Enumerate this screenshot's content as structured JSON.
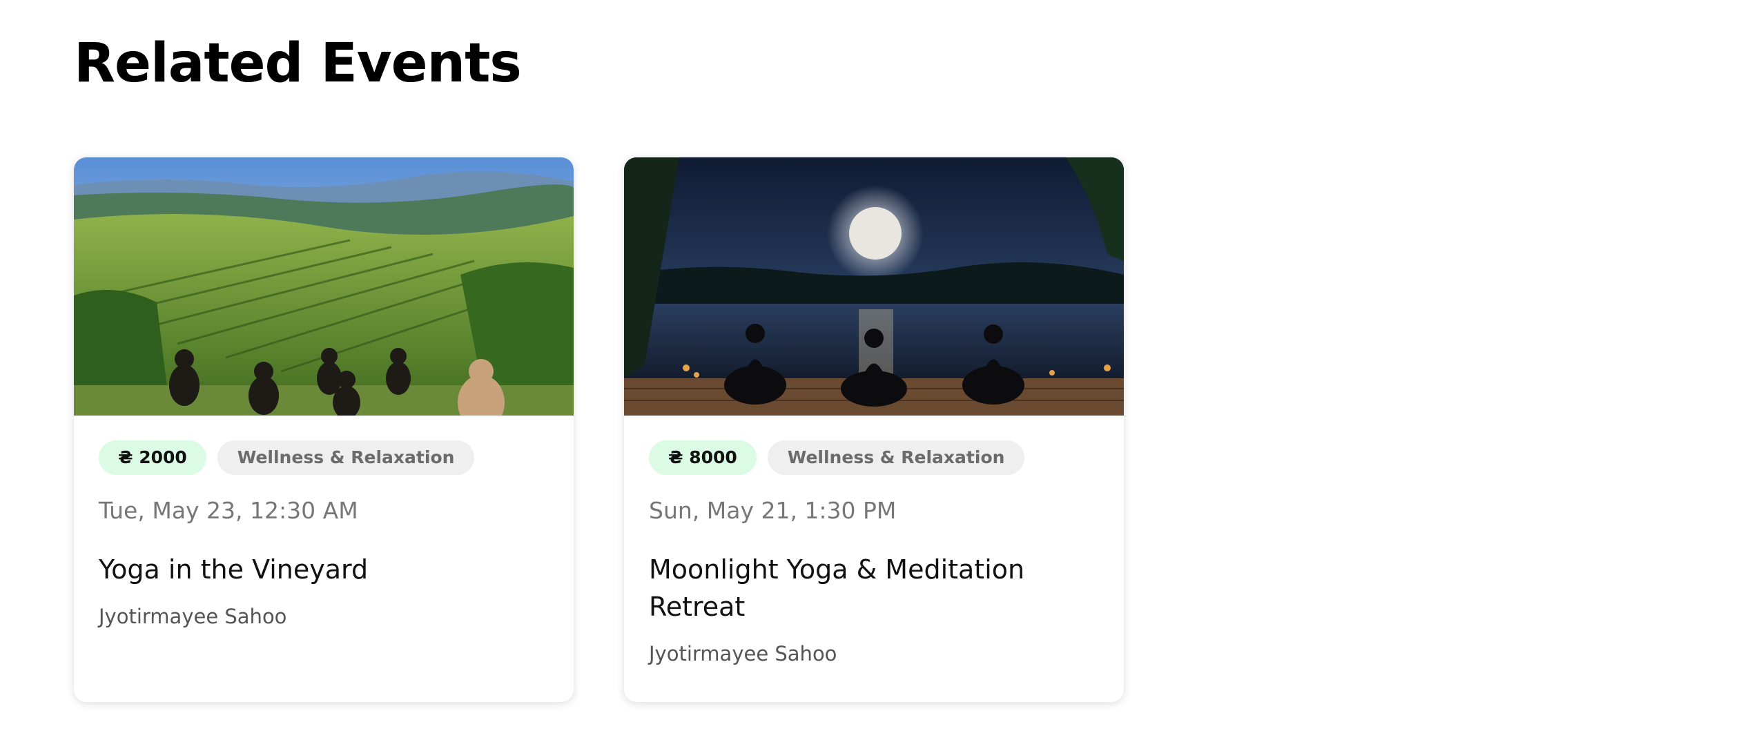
{
  "section": {
    "title": "Related Events"
  },
  "events": [
    {
      "price": "₴ 2000",
      "category": "Wellness & Relaxation",
      "date": "Tue, May 23, 12:30 AM",
      "title": "Yoga in the Vineyard",
      "host": "Jyotirmayee Sahoo"
    },
    {
      "price": "₴ 8000",
      "category": "Wellness & Relaxation",
      "date": "Sun, May 21, 1:30 PM",
      "title": "Moonlight Yoga & Meditation Retreat",
      "host": "Jyotirmayee Sahoo"
    }
  ],
  "colors": {
    "price_tag_bg": "#dcfbe5",
    "category_tag_bg": "#efefef",
    "date_text": "#777777",
    "host_text": "#555555"
  }
}
